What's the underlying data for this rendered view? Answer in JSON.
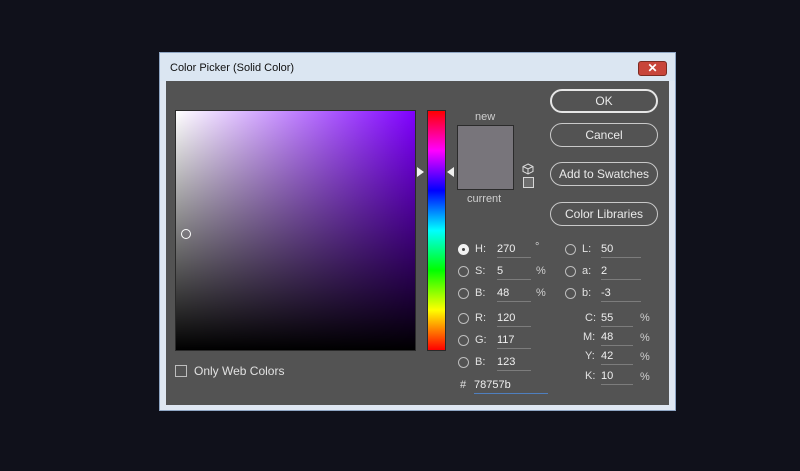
{
  "window": {
    "title": "Color Picker (Solid Color)",
    "close_glyph": "✕"
  },
  "swatch": {
    "new_label": "new",
    "current_label": "current",
    "new_color": "#78757b",
    "current_color": "#78757b"
  },
  "buttons": {
    "ok": "OK",
    "cancel": "Cancel",
    "add_to_swatches": "Add to Swatches",
    "color_libraries": "Color Libraries"
  },
  "hsb": {
    "h": {
      "label": "H:",
      "value": "270",
      "unit": "°",
      "selected": true
    },
    "s": {
      "label": "S:",
      "value": "5",
      "unit": "%"
    },
    "b": {
      "label": "B:",
      "value": "48",
      "unit": "%"
    }
  },
  "rgb": {
    "r": {
      "label": "R:",
      "value": "120"
    },
    "g": {
      "label": "G:",
      "value": "117"
    },
    "b": {
      "label": "B:",
      "value": "123"
    }
  },
  "lab": {
    "l": {
      "label": "L:",
      "value": "50"
    },
    "a": {
      "label": "a:",
      "value": "2"
    },
    "b": {
      "label": "b:",
      "value": "-3"
    }
  },
  "cmyk": {
    "c": {
      "label": "C:",
      "value": "55",
      "unit": "%"
    },
    "m": {
      "label": "M:",
      "value": "48",
      "unit": "%"
    },
    "y": {
      "label": "Y:",
      "value": "42",
      "unit": "%"
    },
    "k": {
      "label": "K:",
      "value": "10",
      "unit": "%"
    }
  },
  "hex": {
    "label": "#",
    "value": "78757b"
  },
  "only_web_colors": {
    "label": "Only Web Colors",
    "checked": false
  }
}
